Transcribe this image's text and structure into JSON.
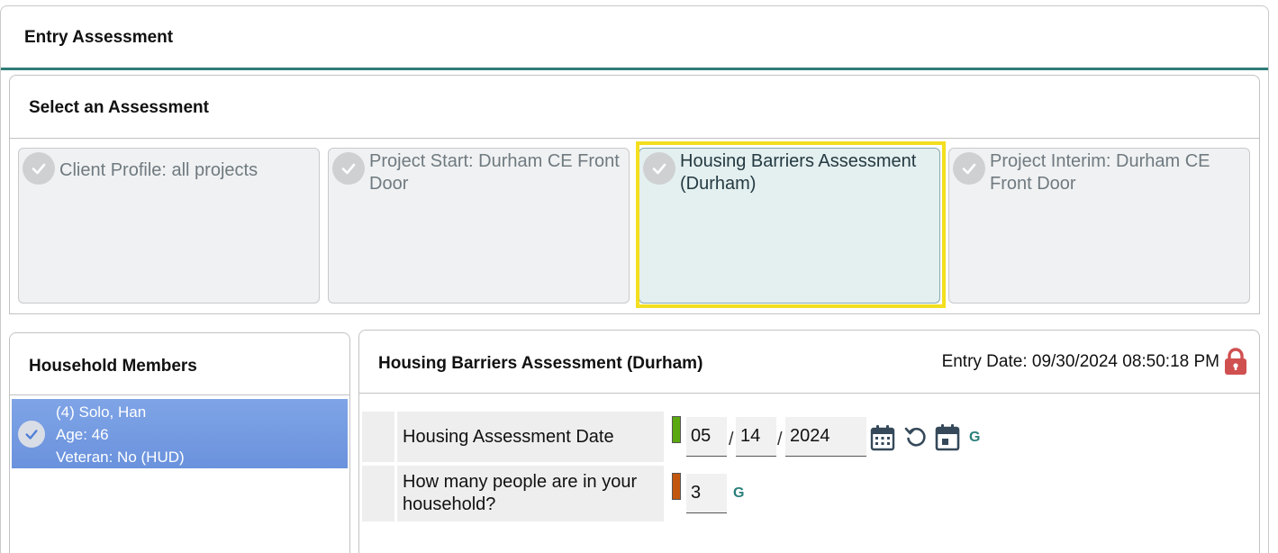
{
  "header": {
    "title": "Entry Assessment"
  },
  "select_assessment": {
    "title": "Select an Assessment",
    "cards": [
      {
        "label": "Client Profile: all projects",
        "selected": false
      },
      {
        "label": "Project Start: Durham CE Front Door",
        "selected": false
      },
      {
        "label": "Housing Barriers Assessment (Durham)",
        "selected": true
      },
      {
        "label": "Project Interim: Durham CE Front Door",
        "selected": false
      }
    ]
  },
  "household": {
    "title": "Household Members",
    "members": [
      {
        "name": "(4) Solo, Han",
        "age": "Age: 46",
        "veteran": "Veteran: No (HUD)"
      }
    ]
  },
  "assessment": {
    "title": "Housing Barriers Assessment (Durham)",
    "entry_date": "Entry Date: 09/30/2024 08:50:18 PM",
    "questions": [
      {
        "label": "Housing Assessment Date",
        "indicator_color": "#5aa80f",
        "month": "05",
        "day": "14",
        "year": "2024",
        "separator": "/",
        "g_link": "G"
      },
      {
        "label": "How many people are in your household?",
        "indicator_color": "#c2560f",
        "value": "3",
        "g_link": "G"
      }
    ]
  },
  "colors": {
    "accent_teal": "#2f7d78",
    "selected_highlight": "#f3df1f",
    "member_selected": "#6a92dd",
    "lock_red": "#d05050"
  }
}
